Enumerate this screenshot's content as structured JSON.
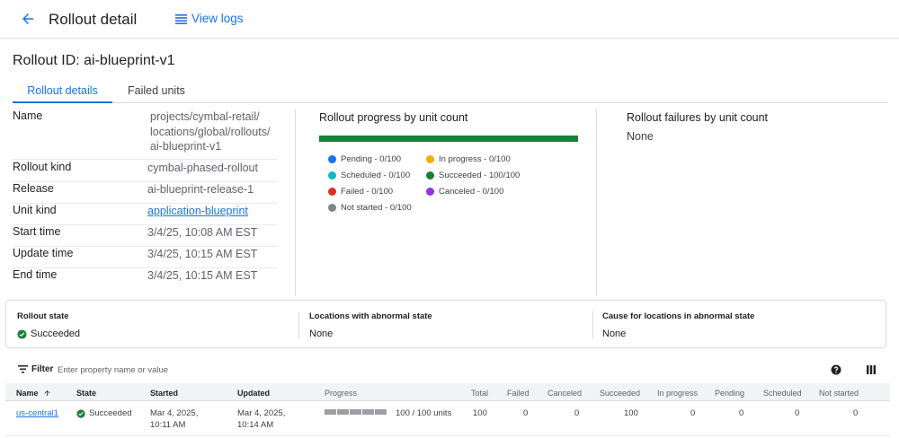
{
  "header": {
    "title": "Rollout detail",
    "view_logs": "View logs"
  },
  "rollout_id_label": "Rollout ID: ai-blueprint-v1",
  "tabs": [
    {
      "label": "Rollout details",
      "active": true
    },
    {
      "label": "Failed units",
      "active": false
    }
  ],
  "properties": {
    "name": {
      "label": "Name",
      "lines": [
        "projects/cymbal-retail/",
        "locations/global/rollouts/",
        "ai-blueprint-v1"
      ]
    },
    "rollout_kind": {
      "label": "Rollout kind",
      "value": "cymbal-phased-rollout"
    },
    "release": {
      "label": "Release",
      "value": "ai-blueprint-release-1"
    },
    "unit_kind": {
      "label": "Unit kind",
      "value": "application-blueprint"
    },
    "start_time": {
      "label": "Start time",
      "value": "3/4/25, 10:08 AM EST"
    },
    "update_time": {
      "label": "Update time",
      "value": "3/4/25, 10:15 AM EST"
    },
    "end_time": {
      "label": "End time",
      "value": "3/4/25, 10:15 AM EST"
    }
  },
  "progress": {
    "title": "Rollout progress by unit count",
    "fraction_complete": 1.0,
    "bar_color": "#188038",
    "legend": [
      {
        "label": "Pending - 0/100",
        "color": "#1a73e8"
      },
      {
        "label": "In progress - 0/100",
        "color": "#f9ab00"
      },
      {
        "label": "Scheduled - 0/100",
        "color": "#12b5cb"
      },
      {
        "label": "Succeeded - 100/100",
        "color": "#188038"
      },
      {
        "label": "Failed - 0/100",
        "color": "#d93025"
      },
      {
        "label": "Canceled - 0/100",
        "color": "#9334e6"
      },
      {
        "label": "Not started - 0/100",
        "color": "#80868b"
      }
    ]
  },
  "failures": {
    "title": "Rollout failures by unit count",
    "value": "None"
  },
  "state_card": {
    "rollout_state": {
      "label": "Rollout state",
      "value": "Succeeded"
    },
    "abnormal_locations": {
      "label": "Locations with abnormal state",
      "value": "None"
    },
    "abnormal_cause": {
      "label": "Cause for locations in abnormal state",
      "value": "None"
    }
  },
  "filter": {
    "label": "Filter",
    "placeholder": "Enter property name or value"
  },
  "table": {
    "columns": [
      "Name",
      "State",
      "Started",
      "Updated",
      "Progress",
      "Total",
      "Failed",
      "Canceled",
      "Succeeded",
      "In progress",
      "Pending",
      "Scheduled",
      "Not started"
    ],
    "rows": [
      {
        "name": "us-central1",
        "state": "Succeeded",
        "started": [
          "Mar 4, 2025,",
          "10:11 AM"
        ],
        "updated": [
          "Mar 4, 2025,",
          "10:14 AM"
        ],
        "progress_text": "100 / 100 units",
        "progress_fraction": 1.0,
        "total": "100",
        "failed": "0",
        "canceled": "0",
        "succeeded": "100",
        "in_progress": "0",
        "pending": "0",
        "scheduled": "0",
        "not_started": "0"
      }
    ]
  },
  "colors": {
    "accent": "#1a73e8",
    "success": "#188038"
  }
}
